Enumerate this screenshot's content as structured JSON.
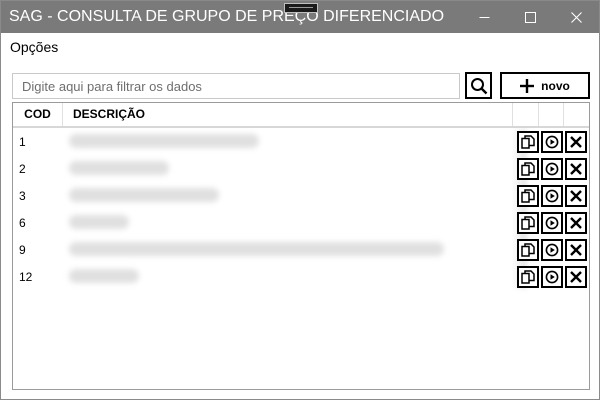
{
  "window": {
    "title": "SAG - CONSULTA DE GRUPO DE PREÇO DIFERENCIADO"
  },
  "menu": {
    "options_label": "Opções"
  },
  "toolbar": {
    "filter_placeholder": "Digite aqui para filtrar os dados",
    "filter_value": "",
    "new_label": "novo"
  },
  "table": {
    "columns": [
      "COD",
      "DESCRIÇÃO"
    ],
    "rows": [
      {
        "cod": "1",
        "descricao": ""
      },
      {
        "cod": "2",
        "descricao": ""
      },
      {
        "cod": "3",
        "descricao": ""
      },
      {
        "cod": "6",
        "descricao": ""
      },
      {
        "cod": "9",
        "descricao": ""
      },
      {
        "cod": "12",
        "descricao": ""
      }
    ]
  },
  "icons": {
    "search": "search-icon",
    "add": "plus-icon",
    "copy": "copy-icon",
    "play": "play-icon",
    "delete": "close-icon",
    "minimize": "minimize-icon",
    "maximize": "maximize-icon",
    "close": "close-icon"
  },
  "colors": {
    "titlebar": "#7a7a7a",
    "title_text": "#ffffff"
  }
}
